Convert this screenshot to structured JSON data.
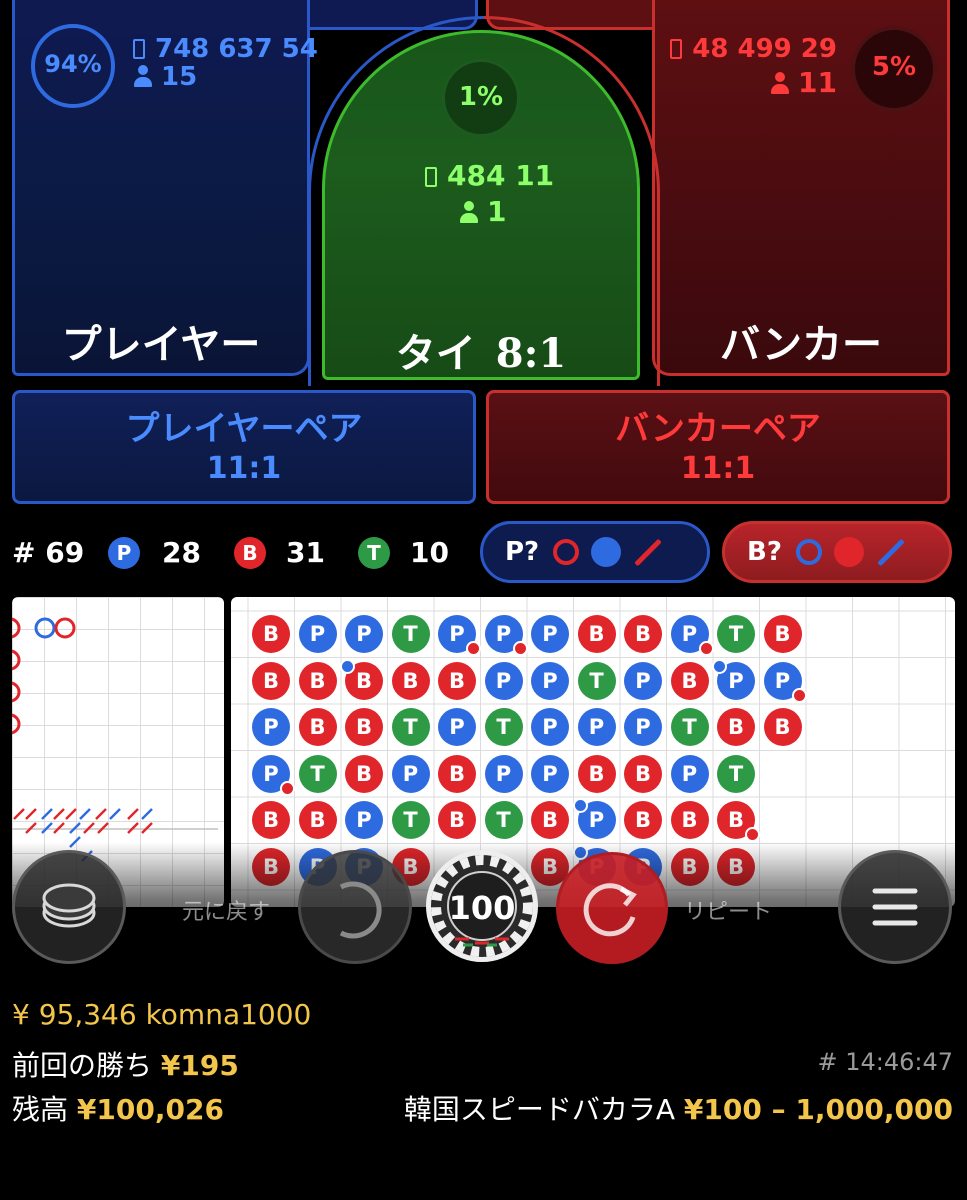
{
  "colors": {
    "player": "#2f6be0",
    "banker": "#e0262b",
    "tie": "#2e9a46",
    "gold": "#f3c54a",
    "player_text": "#4a8cff",
    "banker_text": "#ff3a3a",
    "tie_text": "#8cff6a"
  },
  "player": {
    "percent": "94%",
    "percent_value": 94,
    "amount": "748 637 54",
    "count": "15",
    "label": "プレイヤー"
  },
  "tie": {
    "percent": "1%",
    "percent_value": 1,
    "amount": "484 11",
    "count": "1",
    "label": "タイ",
    "odds": "8:1"
  },
  "banker": {
    "percent": "5%",
    "percent_value": 5,
    "amount": "48 499 29",
    "count": "11",
    "label": "バンカー"
  },
  "pairs": {
    "player": {
      "label": "プレイヤーペア",
      "odds": "11:1"
    },
    "banker": {
      "label": "バンカーペア",
      "odds": "11:1"
    }
  },
  "stats": {
    "round": "# 69",
    "p_badge": "P",
    "p_count": "28",
    "b_badge": "B",
    "b_count": "31",
    "t_badge": "T",
    "t_count": "10"
  },
  "predict": {
    "player_label": "P?",
    "banker_label": "B?"
  },
  "bead_road": [
    [
      "B",
      "P",
      "P",
      "T",
      "P.r",
      "P.r",
      "P",
      "B",
      "B",
      "P.r",
      "T",
      "B"
    ],
    [
      "B",
      "B",
      "B.b",
      "B",
      "B",
      "P",
      "P",
      "T",
      "P",
      "B",
      "P.b",
      "P.r"
    ],
    [
      "P",
      "B",
      "B",
      "T",
      "P",
      "T",
      "P",
      "P",
      "P",
      "T",
      "B",
      "B"
    ],
    [
      "P.r",
      "T",
      "B",
      "P",
      "B",
      "P",
      "P",
      "B",
      "B",
      "P",
      "T",
      ""
    ],
    [
      "B",
      "B",
      "P",
      "T",
      "B",
      "T",
      "B",
      "P.b",
      "B",
      "B",
      "B.r",
      ""
    ],
    [
      "B",
      "P",
      "P",
      "B",
      "",
      "",
      "B",
      "P.b",
      "P",
      "B",
      "B",
      ""
    ]
  ],
  "controls": {
    "undo_label": "元に戻す",
    "chip_value": "100",
    "repeat_label": "リピート"
  },
  "info": {
    "balance_line": "¥ 95,346 komna1000",
    "last_win_label": "前回の勝ち",
    "last_win_value": "¥195",
    "game_id": "# 14:46:47",
    "balance_label": "残高",
    "balance_value": "¥100,026",
    "table_name": "韓国スピードバカラA",
    "limits": "¥100 – 1,000,000"
  }
}
